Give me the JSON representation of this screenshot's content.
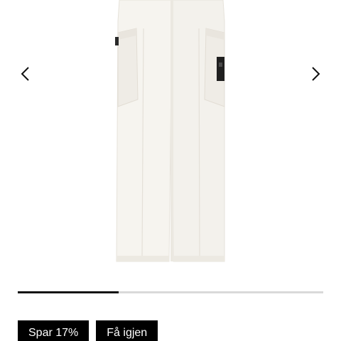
{
  "gallery": {
    "image": {
      "subject": "white cargo trousers",
      "icon": "product-photo"
    },
    "prev_icon": "chevron-left-icon",
    "next_icon": "chevron-right-icon",
    "progress": 0.33
  },
  "badges": [
    {
      "label": "Spar 17%"
    },
    {
      "label": "Få igjen"
    }
  ],
  "colors": {
    "badge_bg": "#000000",
    "badge_text": "#ffffff",
    "progress_fill": "#111111",
    "progress_track": "#d9d9d9"
  }
}
